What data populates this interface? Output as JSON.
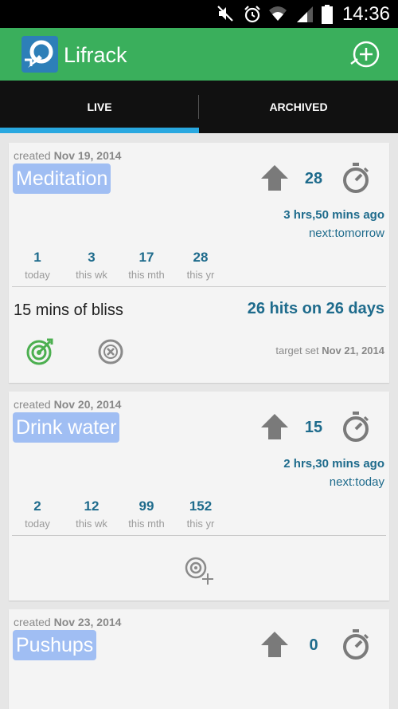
{
  "status_bar": {
    "time": "14:36"
  },
  "app_bar": {
    "title": "Lifrack"
  },
  "tabs": [
    {
      "label": "LIVE",
      "active": true
    },
    {
      "label": "ARCHIVED",
      "active": false
    }
  ],
  "colors": {
    "app_bar": "#3aaf5c",
    "tab_indicator": "#29a8e0",
    "habit_chip": "#a0bef3",
    "accent_text": "#1e6b8c"
  },
  "habits": [
    {
      "created_prefix": "created",
      "created_date": "Nov 19, 2014",
      "name": "Meditation",
      "count": "28",
      "last_ago": "3 hrs,50 mins ago",
      "next": "next:tomorrow",
      "stats": [
        {
          "value": "1",
          "label": "today"
        },
        {
          "value": "3",
          "label": "this wk"
        },
        {
          "value": "17",
          "label": "this mth"
        },
        {
          "value": "28",
          "label": "this yr"
        }
      ],
      "target_note": "15 mins of bliss",
      "target_hits": "26 hits on 26 days",
      "target_set_prefix": "target set",
      "target_set_date": "Nov 21, 2014"
    },
    {
      "created_prefix": "created",
      "created_date": "Nov 20, 2014",
      "name": "Drink water",
      "count": "15",
      "last_ago": "2 hrs,30 mins ago",
      "next": "next:today",
      "stats": [
        {
          "value": "2",
          "label": "today"
        },
        {
          "value": "12",
          "label": "this wk"
        },
        {
          "value": "99",
          "label": "this mth"
        },
        {
          "value": "152",
          "label": "this yr"
        }
      ]
    },
    {
      "created_prefix": "created",
      "created_date": "Nov 23, 2014",
      "name": "Pushups",
      "count": "0"
    }
  ]
}
